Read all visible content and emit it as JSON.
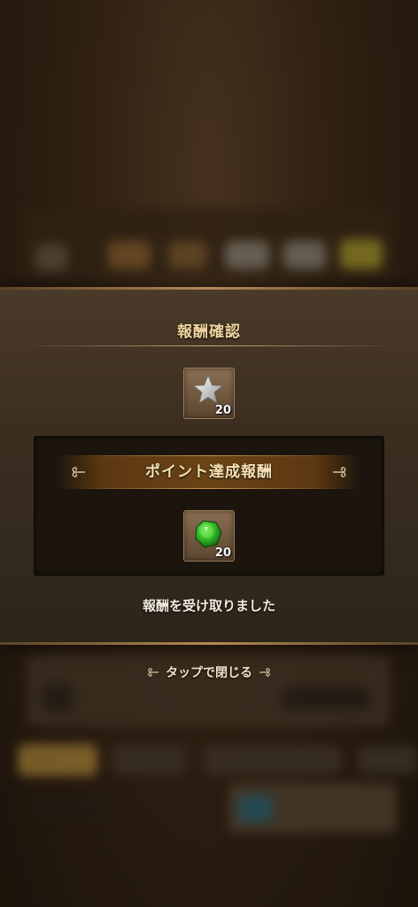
{
  "dialog": {
    "title": "報酬確認",
    "top_reward": {
      "icon": "silver-star-icon",
      "count": "20"
    },
    "section": {
      "label": "ポイント達成報酬",
      "reward": {
        "icon": "green-gem-icon",
        "count": "20"
      }
    },
    "message": "報酬を受け取りました"
  },
  "footer": {
    "close_label": "タップで閉じる"
  },
  "colors": {
    "title_gold": "#f1d6a0",
    "ribbon_brown": "#6a4416",
    "panel_dark": "#1c150e",
    "border_bronze": "#b48b55"
  }
}
